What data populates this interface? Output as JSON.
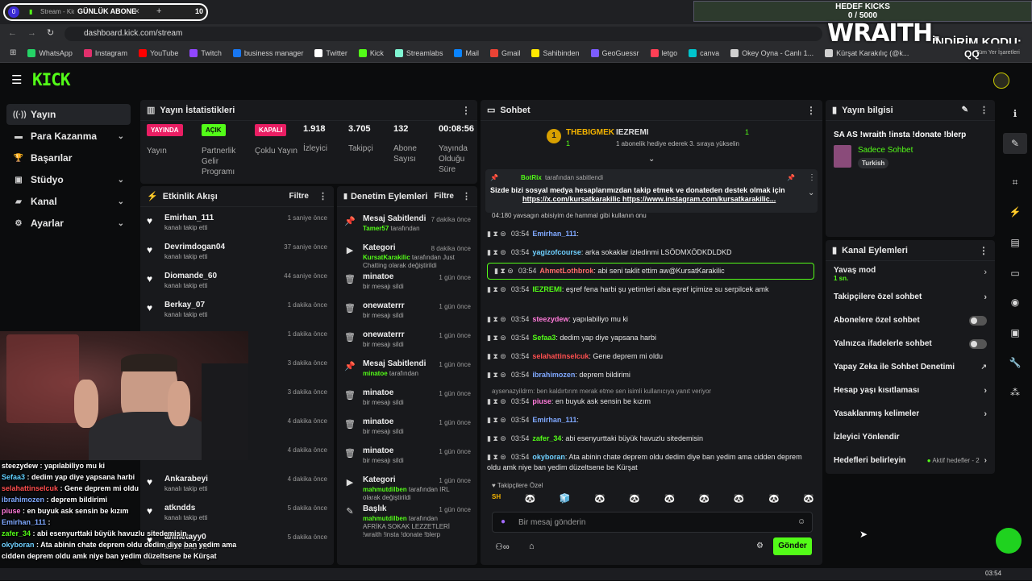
{
  "browser": {
    "tab_title": "Stream - Kick",
    "tab_counter": "0",
    "overlay_sub_label": "GÜNLÜK ABONE",
    "overlay_sub_count": "10",
    "url": "dashboard.kick.com/stream",
    "bookmarks": [
      {
        "label": "WhatsApp",
        "color": "#25d366"
      },
      {
        "label": "Instagram",
        "color": "#e1306c"
      },
      {
        "label": "YouTube",
        "color": "#ff0000"
      },
      {
        "label": "Twitch",
        "color": "#9146ff"
      },
      {
        "label": "business manager",
        "color": "#1877f2"
      },
      {
        "label": "Twitter",
        "color": "#ffffff"
      },
      {
        "label": "Kick",
        "color": "#53fc18"
      },
      {
        "label": "Streamlabs",
        "color": "#80f5d2"
      },
      {
        "label": "Mail",
        "color": "#0a84ff"
      },
      {
        "label": "Gmail",
        "color": "#ea4335"
      },
      {
        "label": "Sahibinden",
        "color": "#ffe800"
      },
      {
        "label": "GeoGuessr",
        "color": "#7b5cff"
      },
      {
        "label": "letgo",
        "color": "#ff3f55"
      },
      {
        "label": "canva",
        "color": "#00c4cc"
      },
      {
        "label": "Okey Oyna - Canlı 1...",
        "color": "#d0d0d0"
      },
      {
        "label": "Kürşat Karakılıç (@k...",
        "color": "#d0d0d0"
      }
    ],
    "bookmarks_right": "Tüm Yer İşaretleri"
  },
  "overlay": {
    "goal_title": "HEDEF KICKS",
    "goal_value": "0 / 5000",
    "brand": "WRAITH.",
    "promo_label": "İNDİRİM KODU:",
    "promo_code": "QQ",
    "taskbar_time": "03:54"
  },
  "sidebar": {
    "items": [
      {
        "label": "Yayın",
        "icon": "broadcast-icon",
        "chev": ""
      },
      {
        "label": "Para Kazanma",
        "icon": "dollar-icon",
        "chev": "⌄"
      },
      {
        "label": "Başarılar",
        "icon": "trophy-icon",
        "chev": ""
      },
      {
        "label": "Stüdyo",
        "icon": "studio-icon",
        "chev": "⌄"
      },
      {
        "label": "Kanal",
        "icon": "channel-icon",
        "chev": "⌄"
      },
      {
        "label": "Ayarlar",
        "icon": "gear-icon",
        "chev": "⌄"
      }
    ]
  },
  "stats": {
    "title": "Yayın İstatistikleri",
    "items": [
      {
        "badge": "YAYINDA",
        "badge_color": "#e91e63",
        "badge_text": "#ffffff",
        "label": "Yayın"
      },
      {
        "badge": "AÇIK",
        "badge_color": "#53fc18",
        "badge_text": "#0b0c0d",
        "label": "Partnerlik Gelir Programı"
      },
      {
        "badge": "KAPALI",
        "badge_color": "#e91e63",
        "badge_text": "#ffffff",
        "label": "Çoklu Yayın"
      },
      {
        "value": "1.918",
        "label": "İzleyici"
      },
      {
        "value": "3.705",
        "label": "Takipçi"
      },
      {
        "value": "132",
        "label": "Abone Sayısı"
      },
      {
        "value": "00:08:56",
        "label": "Yayında Olduğu Süre"
      }
    ]
  },
  "activity": {
    "title": "Etkinlik Akışı",
    "filter": "Filtre",
    "items": [
      {
        "name": "Emirhan_111",
        "sub": "kanalı takip etti",
        "time": "1 saniye önce"
      },
      {
        "name": "Devrimdogan04",
        "sub": "kanalı takip etti",
        "time": "37 saniye önce"
      },
      {
        "name": "Diomande_60",
        "sub": "kanalı takip etti",
        "time": "44 saniye önce"
      },
      {
        "name": "Berkay_07",
        "sub": "kanalı takip etti",
        "time": "1 dakika önce"
      },
      {
        "name": "",
        "sub": "",
        "time": "1 dakika önce"
      },
      {
        "name": "",
        "sub": "",
        "time": "3 dakika önce"
      },
      {
        "name": "",
        "sub": "",
        "time": "3 dakika önce"
      },
      {
        "name": "",
        "sub": "",
        "time": "4 dakika önce"
      },
      {
        "name": "",
        "sub": "",
        "time": "4 dakika önce"
      },
      {
        "name": "Ankarabeyi",
        "sub": "kanalı takip etti",
        "time": "4 dakika önce"
      },
      {
        "name": "atkndds",
        "sub": "kanalı takip etti",
        "time": "5 dakika önce"
      },
      {
        "name": "ahmetayy0",
        "sub": "kanalı takip etti",
        "time": "5 dakika önce"
      }
    ]
  },
  "modlog": {
    "title": "Denetim Eylemleri",
    "filter": "Filtre",
    "items": [
      {
        "icon": "pin-icon",
        "glyph": "📌",
        "title": "Mesaj Sabitlendi",
        "user": "Tamer57",
        "rest": " tarafından",
        "time": "7 dakika önce"
      },
      {
        "icon": "category-icon",
        "glyph": "▶",
        "title": "Kategori",
        "user": "KursatKarakilic",
        "rest": " tarafından Just Chatting olarak değiştirildi",
        "time": "8 dakika önce"
      },
      {
        "icon": "trash-icon",
        "glyph": "🗑",
        "title": "minatoe",
        "user": "",
        "rest": "bir mesajı sildi",
        "time": "1 gün önce"
      },
      {
        "icon": "trash-icon",
        "glyph": "🗑",
        "title": "onewaterrr",
        "user": "",
        "rest": "bir mesajı sildi",
        "time": "1 gün önce"
      },
      {
        "icon": "trash-icon",
        "glyph": "🗑",
        "title": "onewaterrr",
        "user": "",
        "rest": "bir mesajı sildi",
        "time": "1 gün önce"
      },
      {
        "icon": "pin-icon",
        "glyph": "📌",
        "title": "Mesaj Sabitlendi",
        "user": "minatoe",
        "rest": " tarafından",
        "time": "1 gün önce"
      },
      {
        "icon": "trash-icon",
        "glyph": "🗑",
        "title": "minatoe",
        "user": "",
        "rest": "bir mesajı sildi",
        "time": "1 gün önce"
      },
      {
        "icon": "trash-icon",
        "glyph": "🗑",
        "title": "minatoe",
        "user": "",
        "rest": "bir mesajı sildi",
        "time": "1 gün önce"
      },
      {
        "icon": "trash-icon",
        "glyph": "🗑",
        "title": "minatoe",
        "user": "",
        "rest": "bir mesajı sildi",
        "time": "1 gün önce"
      },
      {
        "icon": "category-icon",
        "glyph": "▶",
        "title": "Kategori",
        "user": "mahmutdilben",
        "rest": " tarafından IRL olarak değiştirildi",
        "time": "1 gün önce"
      },
      {
        "icon": "title-icon",
        "glyph": "✎",
        "title": "Başlık",
        "user": "mahmutdilben",
        "rest": " tarafından AFRİKA SOKAK LEZZETLERİ !wraith !insta !donate !blerp",
        "time": "1 gün önce"
      }
    ]
  },
  "chat": {
    "title": "Sohbet",
    "top_user": "THEBIGMEK",
    "top_count": "1",
    "top_rank": "1",
    "gift_user": "IEZREMI",
    "gift_text": "1 abonelik hediye ederek 3. sıraya yükselin",
    "gift_count": "1",
    "pinned_by": "BotRix",
    "pinned_by_suffix": "tarafından sabitlendi",
    "pinned_text": "Sizde bizi sosyal medya hesaplarımızdan takip etmek ve donateden destek olmak için",
    "pinned_links": "https://x.com/kursatkarakilic https://www.instagram.com/kursatkarakilic...",
    "partial_line": "04:180 yavsagın abisiyim de hammal gibi kullanın onu",
    "messages": [
      {
        "time": "03:54",
        "user": "Emirhan_111",
        "color": "#7fa8ff",
        "text": ""
      },
      {
        "time": "03:54",
        "user": "yagizofcourse",
        "color": "#6fd0ff",
        "text": "arka sokaklar izledinmi LSÖDMXÖDKDLDKD"
      },
      {
        "time": "03:54",
        "user": "AhmetLothbrok",
        "color": "#ff6a6a",
        "text": "abi seni taklit ettim aw@KursatKarakilic"
      },
      {
        "time": "03:54",
        "user": "IEZREMI",
        "color": "#53fc18",
        "text": "eşref fena harbi şu yetimleri alsa eşref içimize su serpilcek amk"
      },
      {
        "time": "03:54",
        "user": "steezydew",
        "color": "#ff7ad9",
        "text": "yapılabiliyo mu ki"
      },
      {
        "time": "03:54",
        "user": "Sefaa3",
        "color": "#53fc18",
        "text": "dedim yap diye yapsana harbi"
      },
      {
        "time": "03:54",
        "user": "selahattinselcuk",
        "color": "#ff4f4f",
        "text": "Gene deprem mi oldu"
      },
      {
        "time": "03:54",
        "user": "ibrahimozen",
        "color": "#7fa8ff",
        "text": "deprem bildirimi"
      },
      {
        "time": "03:54",
        "user": "piuse",
        "color": "#ff7ad9",
        "text": "en buyuk ask sensin be kızım"
      },
      {
        "time": "03:54",
        "user": "Emirhan_111",
        "color": "#7fa8ff",
        "text": ""
      },
      {
        "time": "03:54",
        "user": "zafer_34",
        "color": "#53fc18",
        "text": "abi esenyurttaki büyük havuzlu sitedemisin"
      },
      {
        "time": "03:54",
        "user": "okyboran",
        "color": "#6fd0ff",
        "text": "Ata abinin chate deprem oldu dedim diye ban yedim ama cidden deprem oldu amk niye ban yedim düzeltsene be Kürşat"
      }
    ],
    "reply_note": "aysenazyildrm: ben kaldırtırım merak etme sen isimli kullanıcıya yanıt veriyor",
    "followers_only": "Takipçilere Özel",
    "input_placeholder": "Bir mesaj gönderin",
    "send_label": "Gönder"
  },
  "stream_info": {
    "title": "Yayın bilgisi",
    "stream_title": "SA AS !wraith !insta !donate !blerp",
    "category": "Sadece Sohbet",
    "language": "Turkish"
  },
  "channel_actions": {
    "title": "Kanal Eylemleri",
    "slow_mode": "Yavaş mod",
    "slow_mode_value": "1 sn.",
    "items": [
      {
        "label": "Takipçilere özel sohbet",
        "ctrl": "chev"
      },
      {
        "label": "Abonelere özel sohbet",
        "ctrl": "toggle"
      },
      {
        "label": "Yalnızca ifadelerle sohbet",
        "ctrl": "toggle"
      },
      {
        "label": "Yapay Zeka ile Sohbet Denetimi",
        "ctrl": "ext"
      },
      {
        "label": "Hesap yaşı kısıtlaması",
        "ctrl": "chev"
      },
      {
        "label": "Yasaklanmış kelimeler",
        "ctrl": "chev"
      },
      {
        "label": "İzleyici Yönlendir",
        "ctrl": "none"
      }
    ],
    "goals_label": "Hedefleri belirleyin",
    "goals_status": "Aktif hedefler - 2"
  },
  "webcam_chat": [
    {
      "user": "steezydew",
      "color": "#ffffff",
      "text": " : yapılabiliyo mu ki"
    },
    {
      "user": "Sefaa3",
      "color": "#5fd0ff",
      "text": " : dedim yap diye yapsana harbi"
    },
    {
      "user": "selahattinselcuk",
      "color": "#ff4f4f",
      "text": " : Gene deprem mi oldu"
    },
    {
      "user": "ibrahimozen",
      "color": "#7fa8ff",
      "text": " : deprem bildirimi"
    },
    {
      "user": "piuse",
      "color": "#ff7ad9",
      "text": " : en buyuk ask sensin be kızım"
    },
    {
      "user": "Emirhan_111",
      "color": "#7fa8ff",
      "text": " :"
    },
    {
      "user": "zafer_34",
      "color": "#53fc18",
      "text": " : abi esenyurttaki büyük havuzlu sitedemisin"
    },
    {
      "user": "okyboran",
      "color": "#6fd0ff",
      "text": " : Ata abinin chate deprem oldu dedim diye ban yedim ama"
    },
    {
      "user": "",
      "color": "#ffffff",
      "text": "cidden deprem oldu amk niye ban yedim düzeltsene be Kürşat"
    }
  ],
  "colors": {
    "accent": "#53fc18",
    "panel": "#18191c",
    "bg": "#0b0c0d"
  }
}
